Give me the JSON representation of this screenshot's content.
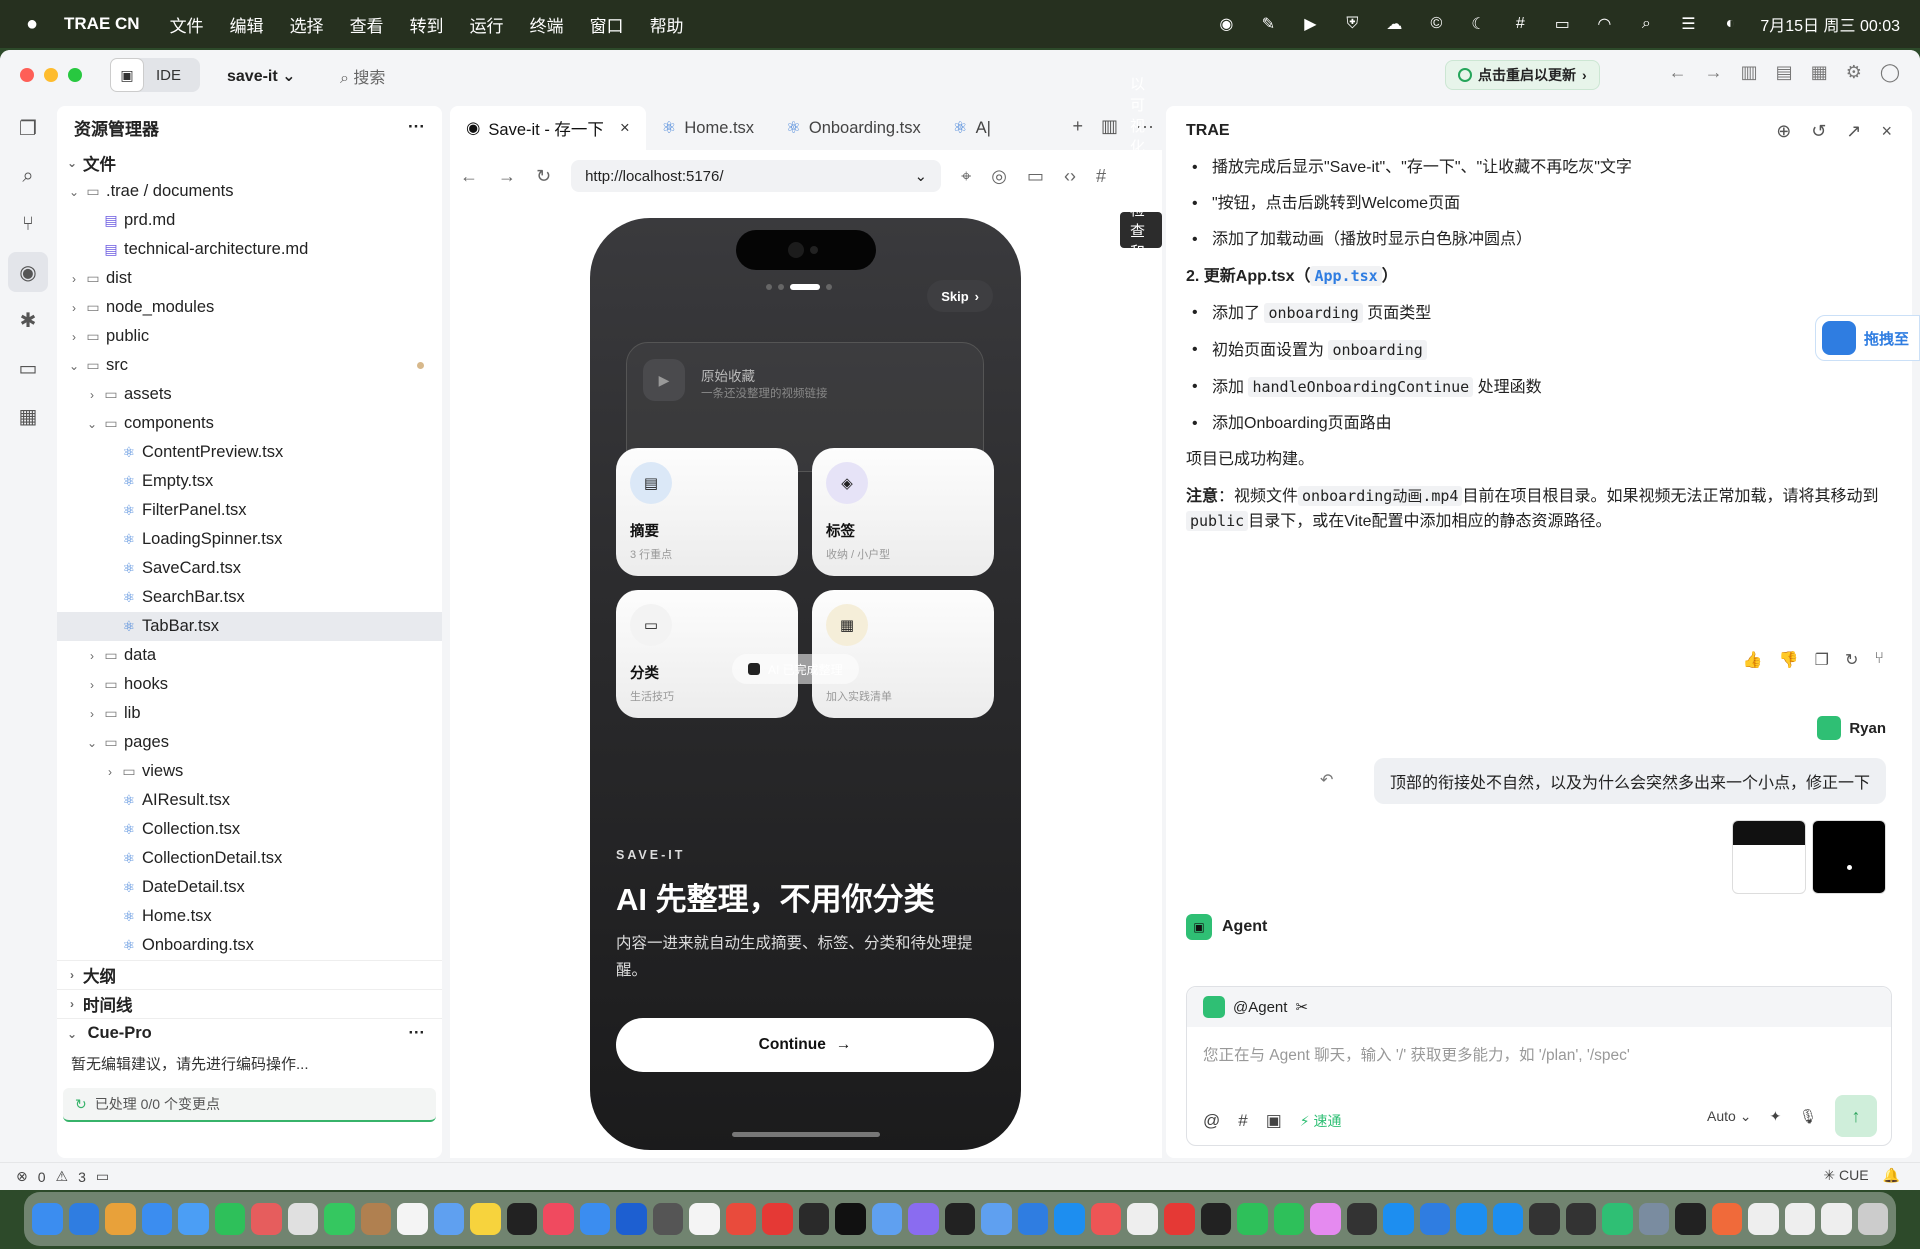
{
  "menubar": {
    "app": "TRAE CN",
    "items": [
      "文件",
      "编辑",
      "选择",
      "查看",
      "转到",
      "运行",
      "终端",
      "窗口",
      "帮助"
    ],
    "datetime": "7月15日 周三 00:03"
  },
  "titlebar": {
    "mode": "IDE",
    "project": "save-it",
    "search": "搜索",
    "update": "点击重启以更新"
  },
  "explorer": {
    "title": "资源管理器",
    "section": "文件",
    "rows": [
      {
        "label": ".trae / documents",
        "depth": 0,
        "type": "folder",
        "open": true
      },
      {
        "label": "prd.md",
        "depth": 1,
        "type": "md"
      },
      {
        "label": "technical-architecture.md",
        "depth": 1,
        "type": "md"
      },
      {
        "label": "dist",
        "depth": 0,
        "type": "folder",
        "open": false
      },
      {
        "label": "node_modules",
        "depth": 0,
        "type": "folder",
        "open": false
      },
      {
        "label": "public",
        "depth": 0,
        "type": "folder",
        "open": false
      },
      {
        "label": "src",
        "depth": 0,
        "type": "folder",
        "open": true,
        "modified": true
      },
      {
        "label": "assets",
        "depth": 1,
        "type": "folder",
        "open": false
      },
      {
        "label": "components",
        "depth": 1,
        "type": "folder",
        "open": true
      },
      {
        "label": "ContentPreview.tsx",
        "depth": 2,
        "type": "react"
      },
      {
        "label": "Empty.tsx",
        "depth": 2,
        "type": "react"
      },
      {
        "label": "FilterPanel.tsx",
        "depth": 2,
        "type": "react"
      },
      {
        "label": "LoadingSpinner.tsx",
        "depth": 2,
        "type": "react"
      },
      {
        "label": "SaveCard.tsx",
        "depth": 2,
        "type": "react"
      },
      {
        "label": "SearchBar.tsx",
        "depth": 2,
        "type": "react"
      },
      {
        "label": "TabBar.tsx",
        "depth": 2,
        "type": "react",
        "selected": true
      },
      {
        "label": "data",
        "depth": 1,
        "type": "folder",
        "open": false
      },
      {
        "label": "hooks",
        "depth": 1,
        "type": "folder",
        "open": false
      },
      {
        "label": "lib",
        "depth": 1,
        "type": "folder",
        "open": false
      },
      {
        "label": "pages",
        "depth": 1,
        "type": "folder",
        "open": true
      },
      {
        "label": "views",
        "depth": 2,
        "type": "folder",
        "open": false
      },
      {
        "label": "AIResult.tsx",
        "depth": 2,
        "type": "react"
      },
      {
        "label": "Collection.tsx",
        "depth": 2,
        "type": "react"
      },
      {
        "label": "CollectionDetail.tsx",
        "depth": 2,
        "type": "react"
      },
      {
        "label": "DateDetail.tsx",
        "depth": 2,
        "type": "react"
      },
      {
        "label": "Home.tsx",
        "depth": 2,
        "type": "react"
      },
      {
        "label": "Onboarding.tsx",
        "depth": 2,
        "type": "react"
      }
    ],
    "outline": "大纲",
    "timeline": "时间线",
    "cue_title": "Cue-Pro",
    "cue_msg": "暂无编辑建议，请先进行编码操作...",
    "cue_status": "已处理 0/0 个变更点"
  },
  "editor": {
    "tabs": [
      {
        "label": "Save-it - 存一下",
        "active": true
      },
      {
        "label": "Home.tsx"
      },
      {
        "label": "Onboarding.tsx"
      },
      {
        "label": "A|"
      }
    ],
    "url": "http://localhost:5176/",
    "tooltip": "以可视化方式检查和编辑页面样式"
  },
  "phone": {
    "skip": "Skip",
    "orig_title": "原始收藏",
    "orig_sub": "一条还没整理的视频链接",
    "cards": [
      {
        "title": "摘要",
        "sub": "3 行重点",
        "icon": "▤",
        "bg": "#dbe8f7"
      },
      {
        "title": "标签",
        "sub": "收纳 / 小户型",
        "icon": "◈",
        "bg": "#e6e3f7"
      },
      {
        "title": "分类",
        "sub": "生活技巧",
        "icon": "▭",
        "bg": "#f3f3f3"
      },
      {
        "title": "",
        "sub": "加入实践清单",
        "icon": "▦",
        "bg": "#f5eed9"
      }
    ],
    "ai_badge": "AI 已完成整理",
    "brand": "SAVE-IT",
    "headline": "AI 先整理，不用你分类",
    "desc": "内容一进来就自动生成摘要、标签、分类和待处理提醒。",
    "continue": "Continue"
  },
  "chat": {
    "title": "TRAE",
    "b1": "播放完成后显示\"Save-it\"、\"存一下\"、\"让收藏不再吃灰\"文字",
    "b2": "\"按钮，点击后跳转到Welcome页面",
    "b3": "添加了加载动画（播放时显示白色脉冲圆点）",
    "h2": "2. 更新App.tsx（",
    "h2_link": "App.tsx",
    "h2_end": "）",
    "c1a": "添加了",
    "c1code": "onboarding",
    "c1b": "页面类型",
    "c2a": "初始页面设置为",
    "c2code": "onboarding",
    "c3a": "添加",
    "c3code": "handleOnboardingContinue",
    "c3b": "处理函数",
    "c4": "添加Onboarding页面路由",
    "p1": "项目已成功构建。",
    "note_label": "注意",
    "note_a": "：视频文件",
    "note_code1": "onboarding动画.mp4",
    "note_b": "目前在项目根目录。如果视频无法正常加载，请将其移动到",
    "note_code2": "public",
    "note_c": "目录下，或在Vite配置中添加相应的静态资源路径。",
    "user": "Ryan",
    "user_msg": "顶部的衔接处不自然，以及为什么会突然多出来一个小点，修正一下",
    "agent": "Agent",
    "input_agent": "@Agent",
    "placeholder": "您正在与 Agent 聊天，输入 '/' 获取更多能力，如 '/plan', '/spec'",
    "speed": "速通",
    "auto": "Auto",
    "float_tag": "拖拽至"
  },
  "statusbar": {
    "errors": "0",
    "warnings": "3",
    "cue": "CUE"
  }
}
